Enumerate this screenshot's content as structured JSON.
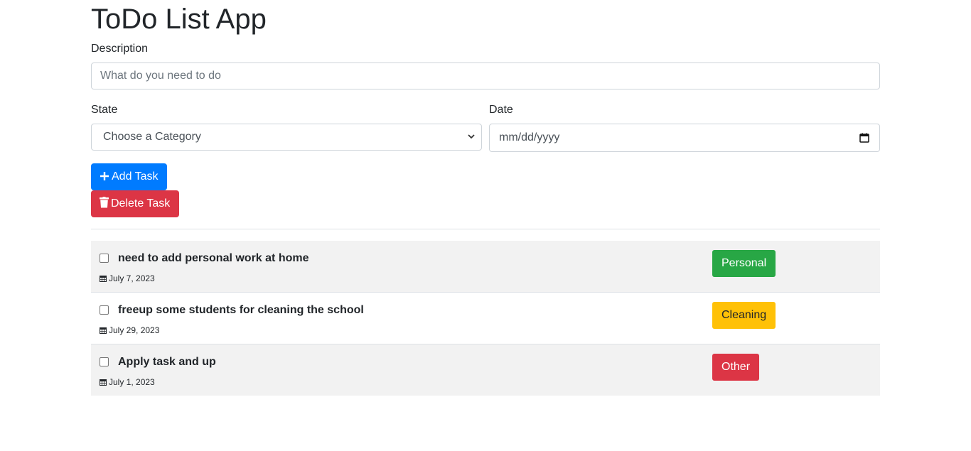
{
  "app": {
    "title": "ToDo List App"
  },
  "form": {
    "description_label": "Description",
    "description_placeholder": "What do you need to do",
    "state_label": "State",
    "state_selected": "Choose a Category",
    "date_label": "Date",
    "date_placeholder": "mm/dd/yyyy"
  },
  "buttons": {
    "add": "Add Task",
    "delete": "Delete Task"
  },
  "tasks": [
    {
      "title": "need to add personal work at home",
      "date": "July 7, 2023",
      "category": "Personal",
      "color": "#28a745",
      "text_color": "#ffffff"
    },
    {
      "title": "freeup some students for cleaning the school",
      "date": "July 29, 2023",
      "category": "Cleaning",
      "color": "#ffc107",
      "text_color": "#212529"
    },
    {
      "title": "Apply task and up",
      "date": "July 1, 2023",
      "category": "Other",
      "color": "#dc3545",
      "text_color": "#ffffff"
    }
  ],
  "colors": {
    "primary": "#007bff",
    "danger": "#dc3545"
  },
  "icons": {
    "add": "plus-icon",
    "delete": "trash-icon",
    "date": "calendar-icon",
    "select": "chevron-down-icon"
  }
}
